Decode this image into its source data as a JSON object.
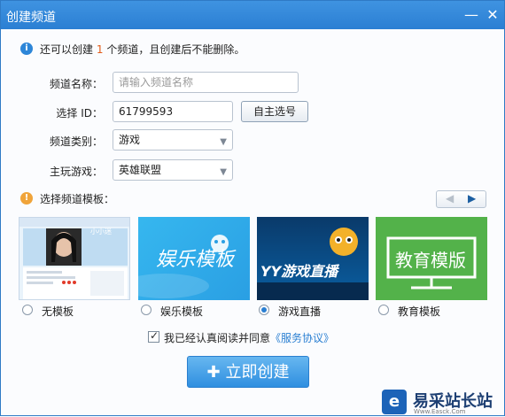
{
  "window": {
    "title": "创建频道",
    "min_icon": "minimize-icon",
    "close_icon": "close-icon"
  },
  "info": {
    "prefix": "还可以创建",
    "count": "1",
    "suffix": "个频道，且创建后不能删除。"
  },
  "form": {
    "name_label": "频道名称：",
    "name_placeholder": "请输入频道名称",
    "id_label": "选择 ID：",
    "id_value": "61799593",
    "self_pick_button": "自主选号",
    "category_label": "频道类别：",
    "category_value": "游戏",
    "game_label": "主玩游戏：",
    "game_value": "英雄联盟"
  },
  "templates": {
    "section_title": "选择频道模板：",
    "items": [
      {
        "label": "无模板",
        "thumb_text": "小小迷",
        "checked": false
      },
      {
        "label": "娱乐模板",
        "thumb_text": "娱乐模板",
        "checked": false
      },
      {
        "label": "游戏直播",
        "thumb_text": "YY游戏直播",
        "checked": true
      },
      {
        "label": "教育模板",
        "thumb_text": "教育模版",
        "checked": false
      }
    ]
  },
  "agreement": {
    "text": "我已经认真阅读并同意",
    "link": "《服务协议》"
  },
  "create_button": "立即创建",
  "watermark": {
    "title": "易采站长站",
    "subtitle": "Www.Easck.Com"
  },
  "colors": {
    "title_bar": "#2b7fd3",
    "accent": "#2a7fd2",
    "count_highlight": "#e25b1a",
    "template_green": "#53b24a"
  }
}
